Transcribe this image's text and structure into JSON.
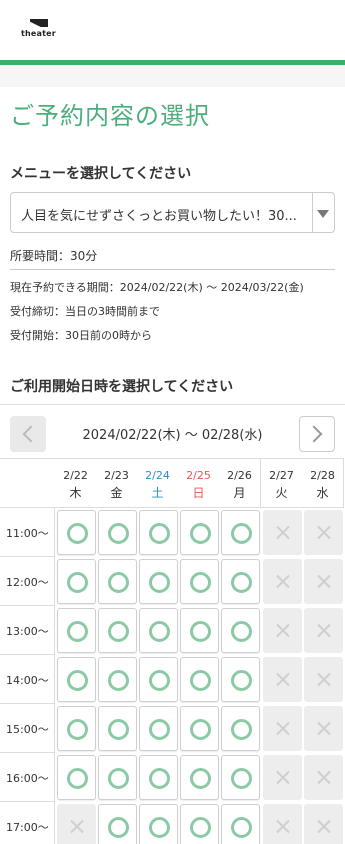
{
  "header": {
    "logo_text": "theater",
    "logo_icon": "theater-logo-icon",
    "accent_color": "#3dae6a"
  },
  "page_title": "ご予約内容の選択",
  "menu_section": {
    "label": "メニューを選択してください",
    "selected": "人目を気にせずさくっとお買い物したい！30..."
  },
  "details": {
    "duration": "所要時間：30分",
    "period": "現在予約できる期間：2024/02/22(木) ～ 2024/03/22(金)",
    "deadline": "受付締切：当日の3時間前まで",
    "start": "受付開始：30日前の0時から"
  },
  "datetime_section": {
    "label": "ご利用開始日時を選択してください"
  },
  "week_nav": {
    "range": "2024/02/22(木) ～ 02/28(水)",
    "prev_icon": "chevron-left-icon",
    "next_icon": "chevron-right-icon"
  },
  "days": [
    {
      "date": "2/22",
      "weekday": "木",
      "color": "#333333"
    },
    {
      "date": "2/23",
      "weekday": "金",
      "color": "#333333"
    },
    {
      "date": "2/24",
      "weekday": "土",
      "color": "#2b8fc7"
    },
    {
      "date": "2/25",
      "weekday": "日",
      "color": "#e05a4e"
    },
    {
      "date": "2/26",
      "weekday": "月",
      "color": "#333333"
    },
    {
      "date": "2/27",
      "weekday": "火",
      "color": "#333333"
    },
    {
      "date": "2/28",
      "weekday": "水",
      "color": "#333333"
    }
  ],
  "times": [
    "11:00～",
    "12:00～",
    "13:00～",
    "14:00～",
    "15:00～",
    "16:00～",
    "17:00～"
  ],
  "availability": [
    [
      true,
      true,
      true,
      true,
      true,
      false,
      false
    ],
    [
      true,
      true,
      true,
      true,
      true,
      false,
      false
    ],
    [
      true,
      true,
      true,
      true,
      true,
      false,
      false
    ],
    [
      true,
      true,
      true,
      true,
      true,
      false,
      false
    ],
    [
      true,
      true,
      true,
      true,
      true,
      false,
      false
    ],
    [
      true,
      true,
      true,
      true,
      true,
      false,
      false
    ],
    [
      false,
      true,
      true,
      true,
      true,
      false,
      false
    ]
  ]
}
